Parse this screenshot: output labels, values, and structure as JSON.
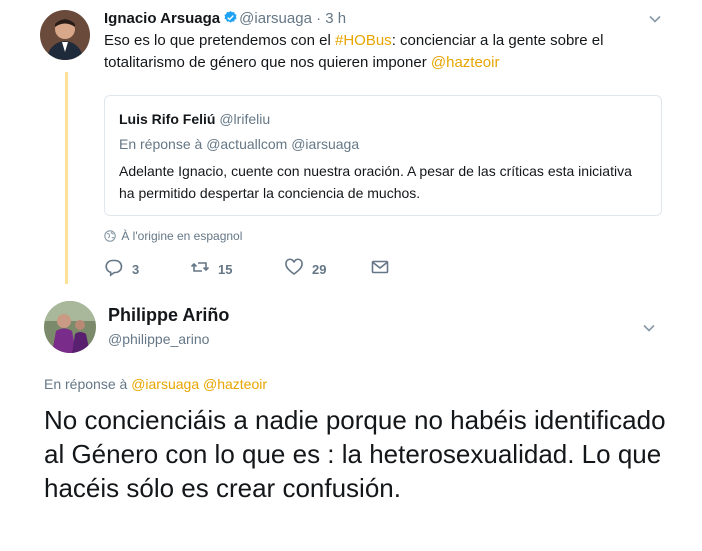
{
  "tweet1": {
    "author_name": "Ignacio Arsuaga",
    "handle": "@iarsuaga",
    "separator": "·",
    "time": "3 h",
    "text_before": "Eso es lo que pretendemos con el ",
    "hashtag": "#HOBus",
    "text_middle": ": concienciar a la gente sobre el totalitarismo de género que nos quieren imponer ",
    "mention": "@hazteoir",
    "quote": {
      "author_name": "Luis Rifo Feliú",
      "handle": "@lrifeliu",
      "reply_prefix": "En réponse à",
      "reply_to": "@actuallcom @iarsuaga",
      "text": "Adelante Ignacio, cuente con nuestra oración. A pesar de las críticas esta iniciativa ha permitido despertar la conciencia de muchos."
    },
    "translation_note": "À l'origine en espagnol",
    "actions": {
      "replies": "3",
      "retweets": "15",
      "likes": "29"
    }
  },
  "tweet2": {
    "author_name": "Philippe Ariño",
    "handle": "@philippe_arino",
    "reply_prefix": "En réponse à",
    "reply_mentions": "@iarsuaga @hazteoir",
    "text": "No concienciáis a nadie porque no habéis identificado al Género con lo que es : la heterosexualidad. Lo que hacéis sólo es crear confusión."
  },
  "colors": {
    "accent_link": "#e8a500",
    "thread_line": "#fbe19a",
    "muted_text": "#657786",
    "verified": "#1da1f2"
  },
  "icons": [
    "verified-badge-icon",
    "chevron-down-icon",
    "globe-icon",
    "reply-icon",
    "retweet-icon",
    "heart-icon",
    "envelope-icon"
  ]
}
